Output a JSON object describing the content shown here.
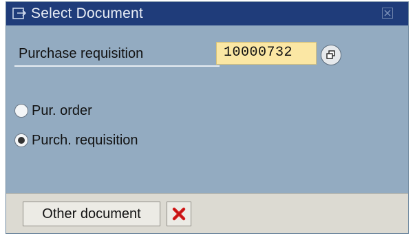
{
  "window": {
    "title": "Select Document",
    "title_icon": "document-select-icon",
    "close_icon": "close-icon"
  },
  "field": {
    "label": "Purchase requisition",
    "value": "10000732",
    "help_icon": "possible-entries-icon"
  },
  "options": [
    {
      "label": "Pur. order",
      "selected": false
    },
    {
      "label": "Purch. requisition",
      "selected": true
    }
  ],
  "footer": {
    "other_document_label": "Other document",
    "cancel_icon": "cancel-x-icon"
  },
  "colors": {
    "titlebar": "#1f3c7a",
    "body": "#93abc1",
    "input_bg": "#fbe7a4",
    "footer": "#dcdad2",
    "cancel_red": "#d81a1a"
  }
}
